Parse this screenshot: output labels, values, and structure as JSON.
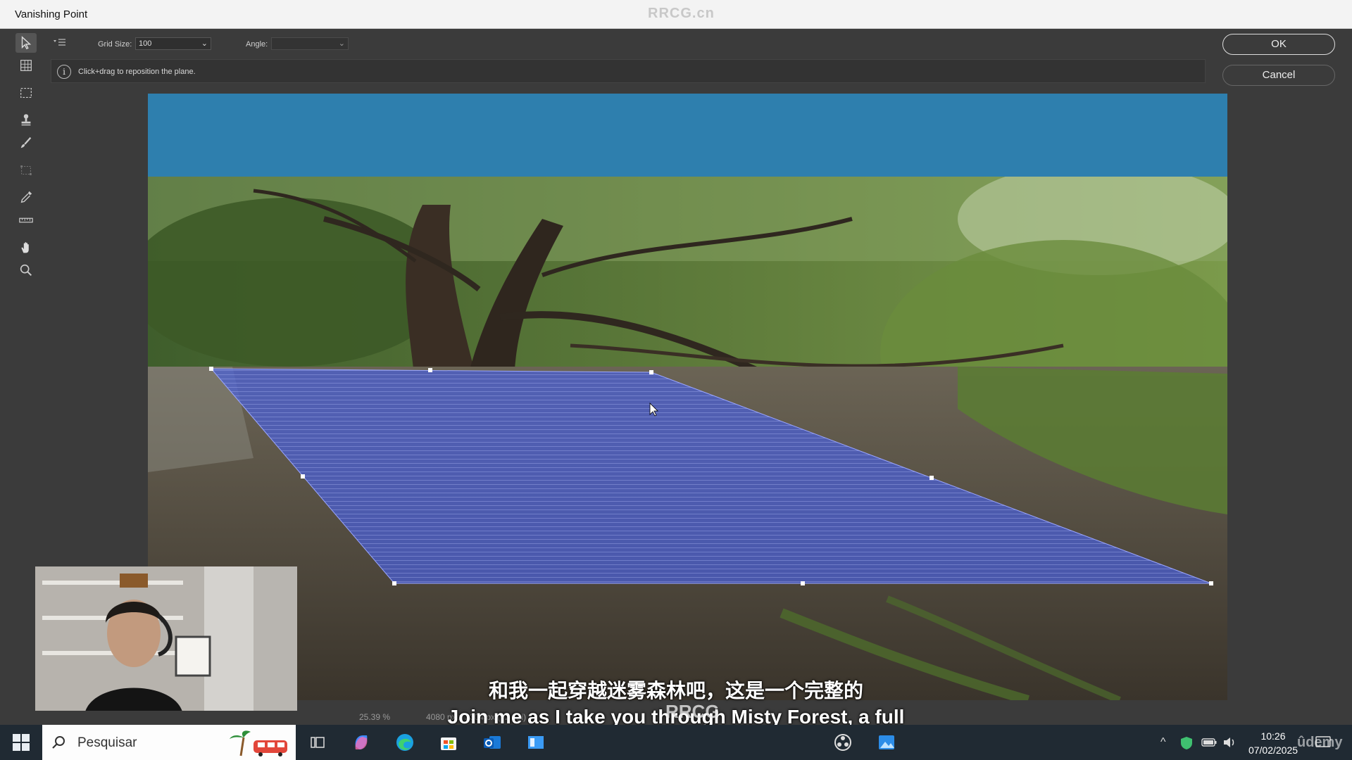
{
  "window": {
    "title": "Vanishing Point",
    "watermark": "RRCG.cn"
  },
  "options": {
    "grid_size_label": "Grid Size:",
    "grid_size_value": "100",
    "angle_label": "Angle:",
    "angle_value": ""
  },
  "message": {
    "text": "Click+drag to reposition the plane."
  },
  "buttons": {
    "ok": "OK",
    "cancel": "Cancel"
  },
  "status": {
    "zoom": "25.39 %",
    "dimensions": "4080 px x 2304 px (72 ppi)"
  },
  "subtitles": {
    "chinese": "和我一起穿越迷雾森林吧，这是一个完整的",
    "english": "Join me as I take you through Misty Forest, a full",
    "watermark": "RRCG"
  },
  "taskbar": {
    "search_placeholder": "Pesquisar",
    "time": "10:26",
    "date": "07/02/2025",
    "overlay_brand": "ûdemy"
  },
  "colors": {
    "sky": "#2e7fae",
    "plane": "#4a5fd8",
    "accent": "#3b3b3b"
  }
}
